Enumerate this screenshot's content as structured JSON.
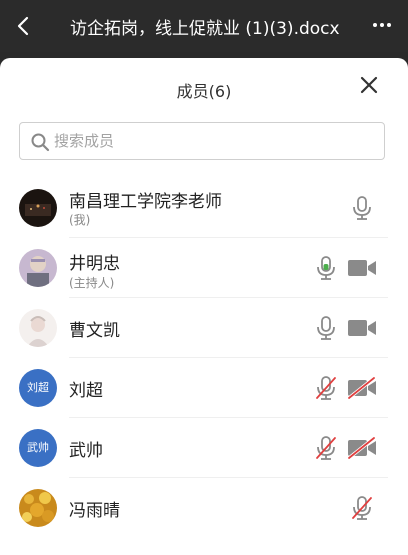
{
  "header": {
    "title": "访企拓岗，线上促就业 (1)(3).docx"
  },
  "panel": {
    "title": "成员(6)",
    "search_placeholder": "搜索成员"
  },
  "members": [
    {
      "name": "南昌理工学院李老师",
      "role": "(我)",
      "mic": "on-gray",
      "camera": "none"
    },
    {
      "name": "井明忠",
      "role": "(主持人)",
      "mic": "on-green",
      "camera": "on"
    },
    {
      "name": "曹文凯",
      "role": "",
      "mic": "on-gray",
      "camera": "on"
    },
    {
      "name": "刘超",
      "role": "",
      "mic": "muted",
      "camera": "off",
      "avatar_text": "刘超"
    },
    {
      "name": "武帅",
      "role": "",
      "mic": "muted",
      "camera": "off",
      "avatar_text": "武帅"
    },
    {
      "name": "冯雨晴",
      "role": "",
      "mic": "muted",
      "camera": "none"
    }
  ],
  "colors": {
    "avatar_blue": "#3a70c4",
    "mic_active": "#4cae4c",
    "muted_red": "#e04040",
    "icon_gray": "#8a8a8a"
  }
}
